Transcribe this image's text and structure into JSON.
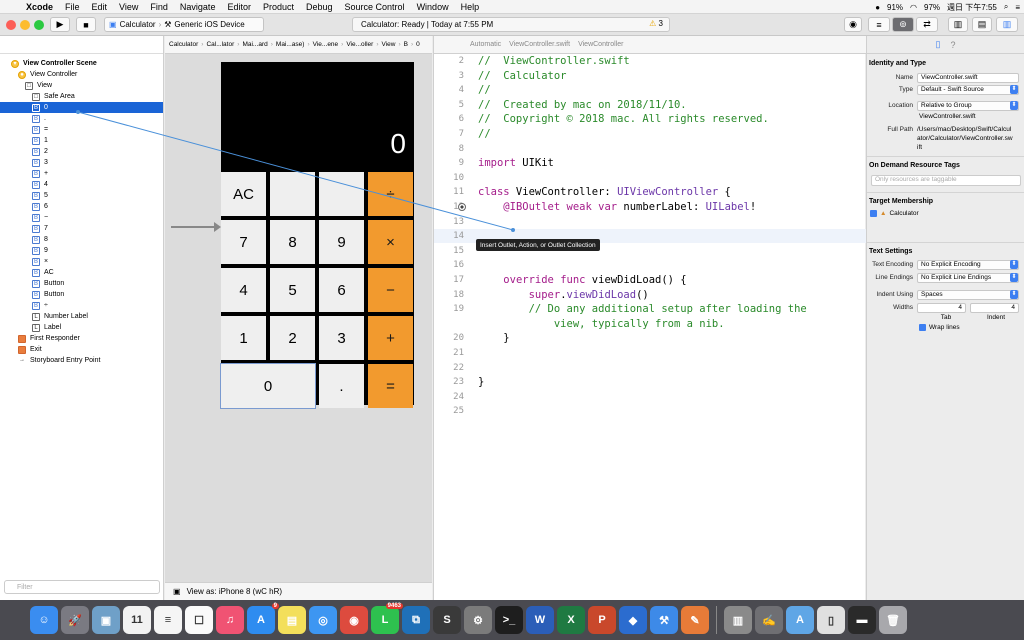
{
  "menubar": {
    "app": "Xcode",
    "items": [
      "File",
      "Edit",
      "View",
      "Find",
      "Navigate",
      "Editor",
      "Product",
      "Debug",
      "Source Control",
      "Window",
      "Help"
    ],
    "battery": "91%",
    "battery2": "97%",
    "clock": "週日 下午7:55"
  },
  "toolbar": {
    "scheme": "Calculator",
    "device": "Generic iOS Device",
    "status": "Calculator: Ready | Today at 7:55 PM",
    "warnings": "3"
  },
  "navigator": {
    "tree": [
      {
        "label": "View Controller Scene",
        "badge": "▾",
        "kind": "scene",
        "indent": 1
      },
      {
        "label": "View Controller",
        "badge": "●",
        "kind": "scene",
        "indent": 2
      },
      {
        "label": "View",
        "badge": "□",
        "kind": "lbl",
        "indent": 3
      },
      {
        "label": "Safe Area",
        "badge": "□",
        "kind": "lbl",
        "indent": 4
      },
      {
        "label": "0",
        "badge": "B",
        "kind": "btn",
        "indent": 4,
        "selected": true
      },
      {
        "label": ".",
        "badge": "B",
        "kind": "btn",
        "indent": 4
      },
      {
        "label": "=",
        "badge": "B",
        "kind": "btn",
        "indent": 4
      },
      {
        "label": "1",
        "badge": "B",
        "kind": "btn",
        "indent": 4
      },
      {
        "label": "2",
        "badge": "B",
        "kind": "btn",
        "indent": 4
      },
      {
        "label": "3",
        "badge": "B",
        "kind": "btn",
        "indent": 4
      },
      {
        "label": "+",
        "badge": "B",
        "kind": "btn",
        "indent": 4
      },
      {
        "label": "4",
        "badge": "B",
        "kind": "btn",
        "indent": 4
      },
      {
        "label": "5",
        "badge": "B",
        "kind": "btn",
        "indent": 4
      },
      {
        "label": "6",
        "badge": "B",
        "kind": "btn",
        "indent": 4
      },
      {
        "label": "−",
        "badge": "B",
        "kind": "btn",
        "indent": 4
      },
      {
        "label": "7",
        "badge": "B",
        "kind": "btn",
        "indent": 4
      },
      {
        "label": "8",
        "badge": "B",
        "kind": "btn",
        "indent": 4
      },
      {
        "label": "9",
        "badge": "B",
        "kind": "btn",
        "indent": 4
      },
      {
        "label": "×",
        "badge": "B",
        "kind": "btn",
        "indent": 4
      },
      {
        "label": "AC",
        "badge": "B",
        "kind": "btn",
        "indent": 4
      },
      {
        "label": "Button",
        "badge": "B",
        "kind": "btn",
        "indent": 4
      },
      {
        "label": "Button",
        "badge": "B",
        "kind": "btn",
        "indent": 4
      },
      {
        "label": "÷",
        "badge": "B",
        "kind": "btn",
        "indent": 4
      },
      {
        "label": "Number Label",
        "badge": "L",
        "kind": "lbl",
        "indent": 4
      },
      {
        "label": "Label",
        "badge": "L",
        "kind": "lbl",
        "indent": 4
      },
      {
        "label": "First Responder",
        "badge": "",
        "kind": "resp",
        "indent": 2
      },
      {
        "label": "Exit",
        "badge": "",
        "kind": "exit",
        "indent": 2
      },
      {
        "label": "Storyboard Entry Point",
        "badge": "→",
        "kind": "plain",
        "indent": 2
      }
    ],
    "filter_placeholder": "Filter"
  },
  "canvas": {
    "jump": [
      "Calculator",
      "Cal...lator",
      "Mai...ard",
      "Mai...ase)",
      "Vie...ene",
      "Vie...oller",
      "View",
      "B",
      "0"
    ],
    "display": "0",
    "keys": [
      [
        "AC",
        "",
        "",
        "÷"
      ],
      [
        "7",
        "8",
        "9",
        "×"
      ],
      [
        "4",
        "5",
        "6",
        "−"
      ],
      [
        "1",
        "2",
        "3",
        "+"
      ],
      [
        "0",
        ".",
        "="
      ]
    ],
    "view_as": "View as: iPhone 8 (wC hR)"
  },
  "editor": {
    "jump": [
      "Automatic",
      "ViewController.swift",
      "ViewController"
    ],
    "lines": [
      {
        "n": "2",
        "t": "//  ViewController.swift",
        "cls": "cmt"
      },
      {
        "n": "3",
        "t": "//  Calculator",
        "cls": "cmt"
      },
      {
        "n": "4",
        "t": "//",
        "cls": "cmt"
      },
      {
        "n": "5",
        "t": "//  Created by mac on 2018/11/10.",
        "cls": "cmt"
      },
      {
        "n": "6",
        "t": "//  Copyright © 2018 mac. All rights reserved.",
        "cls": "cmt"
      },
      {
        "n": "7",
        "t": "//",
        "cls": "cmt"
      },
      {
        "n": "8",
        "t": "",
        "cls": ""
      },
      {
        "n": "9",
        "t": "import UIKit",
        "cls": "import"
      },
      {
        "n": "10",
        "t": "",
        "cls": ""
      },
      {
        "n": "11",
        "t": "class ViewController: UIViewController {",
        "cls": "class"
      },
      {
        "n": "12",
        "t": "    @IBOutlet weak var numberLabel: UILabel!",
        "cls": "outlet"
      },
      {
        "n": "13",
        "t": "",
        "cls": ""
      },
      {
        "n": "14",
        "t": "",
        "cls": "cur"
      },
      {
        "n": "15",
        "t": "",
        "cls": ""
      },
      {
        "n": "16",
        "t": "",
        "cls": ""
      },
      {
        "n": "17",
        "t": "    override func viewDidLoad() {",
        "cls": "func"
      },
      {
        "n": "18",
        "t": "        super.viewDidLoad()",
        "cls": "super"
      },
      {
        "n": "19",
        "t": "        // Do any additional setup after loading the",
        "cls": "cmt"
      },
      {
        "n": "",
        "t": "            view, typically from a nib.",
        "cls": "cmt"
      },
      {
        "n": "20",
        "t": "    }",
        "cls": ""
      },
      {
        "n": "21",
        "t": "",
        "cls": ""
      },
      {
        "n": "22",
        "t": "",
        "cls": ""
      },
      {
        "n": "23",
        "t": "}",
        "cls": ""
      },
      {
        "n": "24",
        "t": "",
        "cls": ""
      },
      {
        "n": "25",
        "t": "",
        "cls": ""
      }
    ],
    "tooltip": "Insert Outlet, Action, or Outlet Collection"
  },
  "inspector": {
    "identity_title": "Identity and Type",
    "name_label": "Name",
    "name_value": "ViewController.swift",
    "type_label": "Type",
    "type_value": "Default - Swift Source",
    "location_label": "Location",
    "location_value": "Relative to Group",
    "location_file": "ViewController.swift",
    "fullpath_label": "Full Path",
    "fullpath_value": "/Users/mac/Desktop/Swift/Calculator/Calculator/ViewController.swift",
    "odr_title": "On Demand Resource Tags",
    "odr_placeholder": "Only resources are taggable",
    "target_title": "Target Membership",
    "target_value": "Calculator",
    "text_title": "Text Settings",
    "encoding_label": "Text Encoding",
    "encoding_value": "No Explicit Encoding",
    "endings_label": "Line Endings",
    "endings_value": "No Explicit Line Endings",
    "indent_label": "Indent Using",
    "indent_value": "Spaces",
    "widths_label": "Widths",
    "tab_value": "4",
    "indent_width_value": "4",
    "tab_caption": "Tab",
    "indent_caption": "Indent",
    "wrap_label": "Wrap lines"
  },
  "dock": {
    "apps": [
      {
        "name": "finder-icon",
        "color": "#3a8df0",
        "glyph": "☺"
      },
      {
        "name": "launchpad-icon",
        "color": "#7a7a82",
        "glyph": "🚀"
      },
      {
        "name": "photos-icon",
        "color": "#6fa0c8",
        "glyph": "▣"
      },
      {
        "name": "calendar-icon",
        "color": "#f2f2f2",
        "glyph": "11"
      },
      {
        "name": "notes-icon",
        "color": "#f5f5f5",
        "glyph": "≡"
      },
      {
        "name": "reminders-icon",
        "color": "#fafafa",
        "glyph": "☐"
      },
      {
        "name": "music-icon",
        "color": "#f05373",
        "glyph": "♫"
      },
      {
        "name": "appstore-icon",
        "color": "#2e8cf0",
        "glyph": "A"
      },
      {
        "name": "stickies-icon",
        "color": "#f3df5b",
        "glyph": "▤"
      },
      {
        "name": "safari-icon",
        "color": "#3d96f2",
        "glyph": "◎"
      },
      {
        "name": "chrome-icon",
        "color": "#dd4b3e",
        "glyph": "◉"
      },
      {
        "name": "line-icon",
        "color": "#2ec14f",
        "glyph": "L"
      },
      {
        "name": "vscode-icon",
        "color": "#1f70b8",
        "glyph": "⧉"
      },
      {
        "name": "sublime-icon",
        "color": "#3a3a3a",
        "glyph": "S"
      },
      {
        "name": "preferences-icon",
        "color": "#7b7b7b",
        "glyph": "⚙"
      },
      {
        "name": "terminal-icon",
        "color": "#1e1e1e",
        "glyph": ">_"
      },
      {
        "name": "word-icon",
        "color": "#2b5eb8",
        "glyph": "W"
      },
      {
        "name": "excel-icon",
        "color": "#1f7a42",
        "glyph": "X"
      },
      {
        "name": "powerpoint-icon",
        "color": "#c9482b",
        "glyph": "P"
      },
      {
        "name": "sourcetree-icon",
        "color": "#2b6ccf",
        "glyph": "◆"
      },
      {
        "name": "xcode-icon",
        "color": "#3d8ae8",
        "glyph": "⚒"
      },
      {
        "name": "instruments-icon",
        "color": "#e77b38",
        "glyph": "✎"
      },
      {
        "name": "preview-icon",
        "color": "#8a8a8a",
        "glyph": "▥"
      },
      {
        "name": "editor-icon",
        "color": "#6f6f73",
        "glyph": "✍"
      },
      {
        "name": "folder-icon",
        "color": "#5fa6e6",
        "glyph": "A"
      },
      {
        "name": "mobile-icon",
        "color": "#e0e0e0",
        "glyph": "▯"
      },
      {
        "name": "terminal2-icon",
        "color": "#2a2a2a",
        "glyph": "▬"
      },
      {
        "name": "trash-icon",
        "color": "#a8a8ac",
        "glyph": "🗑"
      }
    ],
    "badges": {
      "appstore": "9",
      "line": "9463"
    }
  },
  "colors": {
    "accent": "#1a64d6",
    "operator": "#f29a2e",
    "key": "#efefef"
  }
}
